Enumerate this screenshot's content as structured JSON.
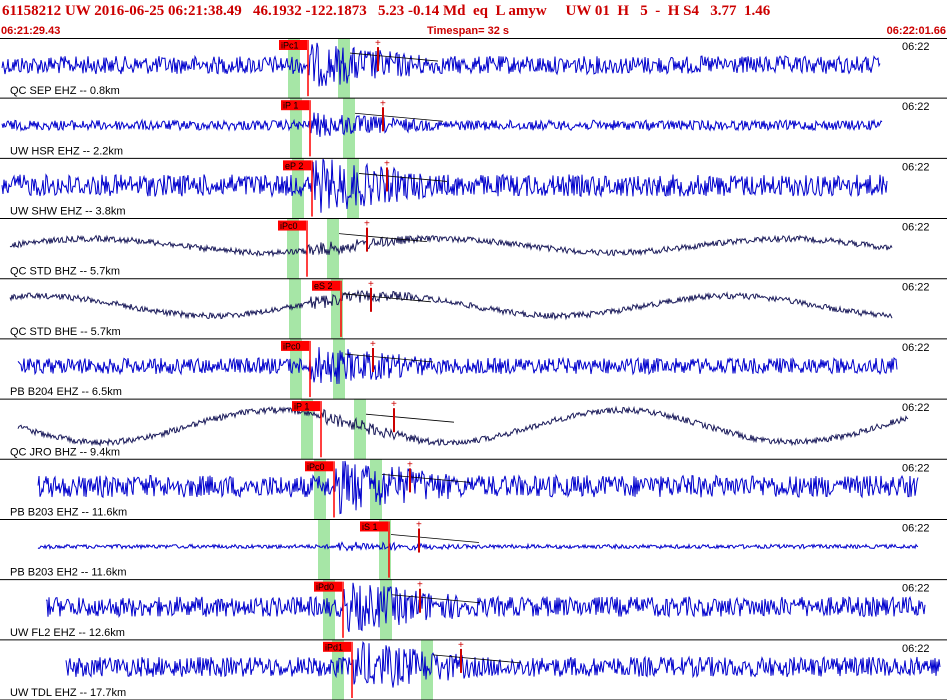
{
  "header": {
    "event_id": "61158212",
    "network": "UW",
    "datetime": "2016-06-25 06:21:38.49",
    "lat": "46.1932",
    "lon": "-122.1873",
    "depth": "5.23",
    "magnitude": "-0.14",
    "mag_type": "Md",
    "event_type": "eq",
    "flags": "L",
    "analyst": "amyw",
    "origin_net": "UW",
    "version": "01",
    "quality": "H",
    "num": "5",
    "dash": "-",
    "rank": "H",
    "s_code": "S4",
    "val_a": "3.77",
    "val_b": "1.46",
    "start_time": "06:21:29.43",
    "timespan": "Timespan=  32 s",
    "end_time": "06:22:01.66"
  },
  "colors": {
    "header_text": "#cc0000",
    "trace_blue": "#0000cc",
    "trace_dark": "#1a1a5a",
    "pick_red": "#ff0000",
    "pick_fill": "#ff0000",
    "pick_green": "#a6e6a6",
    "amp_red": "#cc0000"
  },
  "traces": [
    {
      "label": "QC SEP EHZ -- 0.8km",
      "time": "06:22",
      "pick": "iPc1",
      "pick_kind": "P"
    },
    {
      "label": "UW HSR EHZ -- 2.2km",
      "time": "06:22",
      "pick": "iP 1",
      "pick_kind": "P"
    },
    {
      "label": "UW SHW EHZ -- 3.8km",
      "time": "06:22",
      "pick": "eP 2",
      "pick_kind": "P"
    },
    {
      "label": "QC STD BHZ -- 5.7km",
      "time": "06:22",
      "pick": "iPc0",
      "pick_kind": "P"
    },
    {
      "label": "QC STD BHE -- 5.7km",
      "time": "06:22",
      "pick": "eS 2",
      "pick_kind": "S"
    },
    {
      "label": "PB B204 EHZ -- 6.5km",
      "time": "06:22",
      "pick": "iPc0",
      "pick_kind": "P"
    },
    {
      "label": "QC JRO BHZ -- 9.4km",
      "time": "06:22",
      "pick": "iP 1",
      "pick_kind": "P"
    },
    {
      "label": "PB B203 EHZ -- 11.6km",
      "time": "06:22",
      "pick": "iPc0",
      "pick_kind": "P"
    },
    {
      "label": "PB B203 EH2 -- 11.6km",
      "time": "06:22",
      "pick": "iS 1",
      "pick_kind": "S"
    },
    {
      "label": "UW FL2 EHZ -- 12.6km",
      "time": "06:22",
      "pick": "iPd0",
      "pick_kind": "P"
    },
    {
      "label": "UW TDL EHZ -- 17.7km",
      "time": "06:22",
      "pick": "iPd1",
      "pick_kind": "P"
    }
  ]
}
